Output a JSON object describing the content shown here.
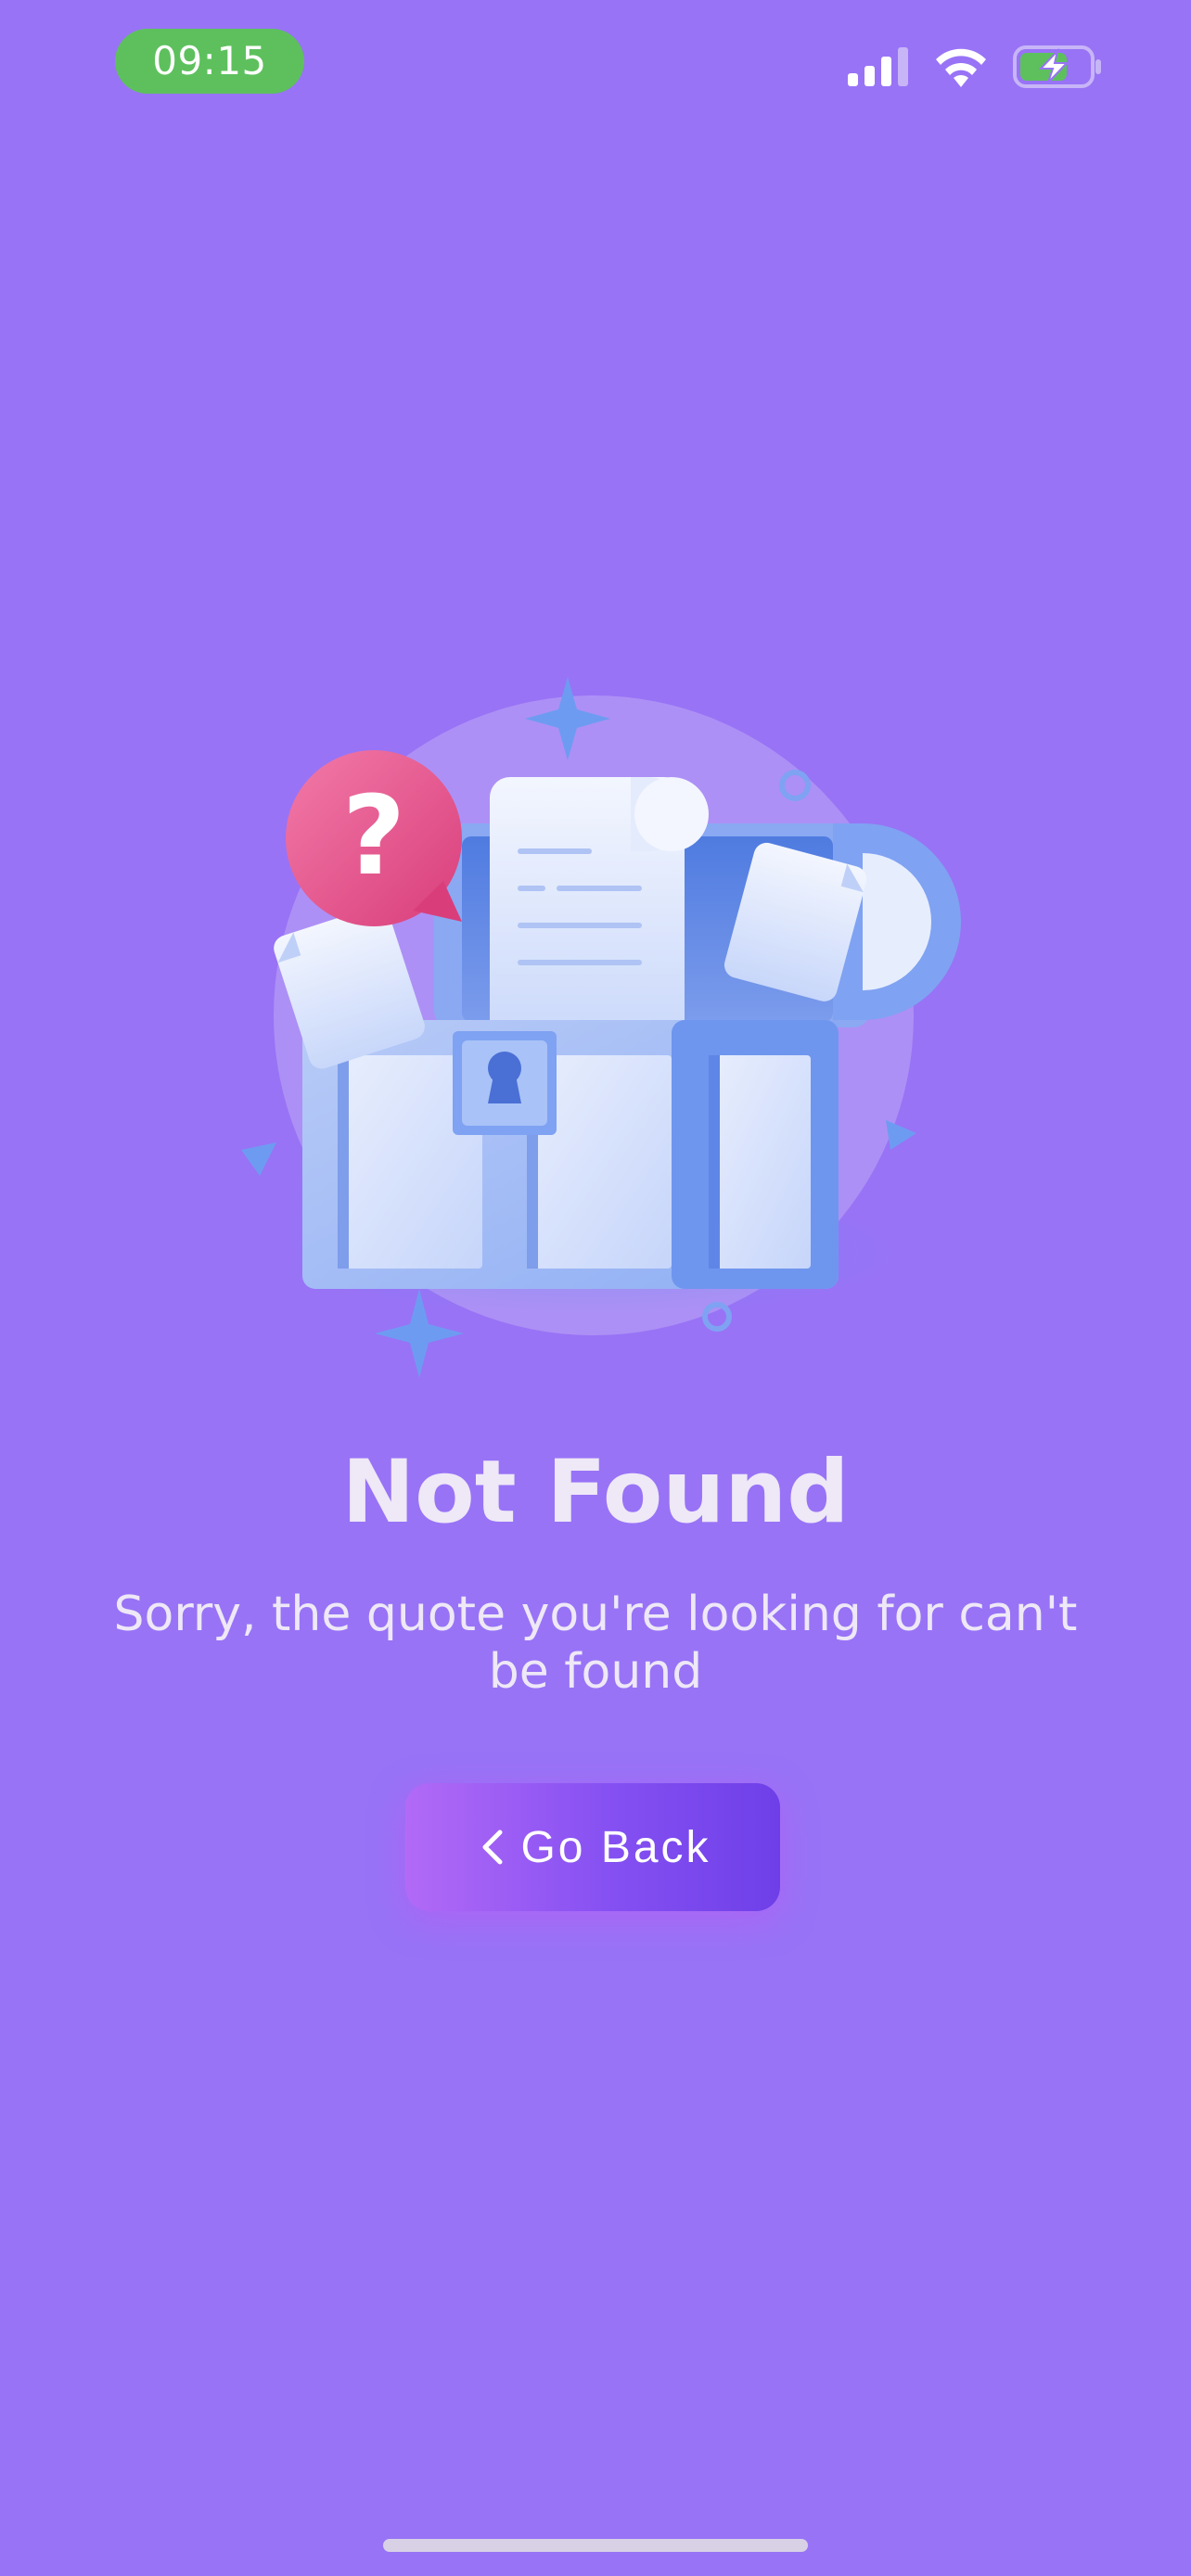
{
  "status_bar": {
    "time": "09:15",
    "icons": [
      "cellular-signal-icon",
      "wifi-icon",
      "battery-charging-icon"
    ]
  },
  "illustration": {
    "name": "treasure-chest-not-found",
    "question_mark": "?"
  },
  "main": {
    "title": "Not Found",
    "subtitle": "Sorry, the quote you're looking for can't be found",
    "button_label": "Go Back",
    "button_icon": "chevron-left-icon"
  },
  "colors": {
    "background": "#9873F6",
    "time_pill": "#5DC05D",
    "button_gradient_start": "#B26AF6",
    "button_gradient_end": "#6E3FE8",
    "text": "#EEE8F7"
  }
}
